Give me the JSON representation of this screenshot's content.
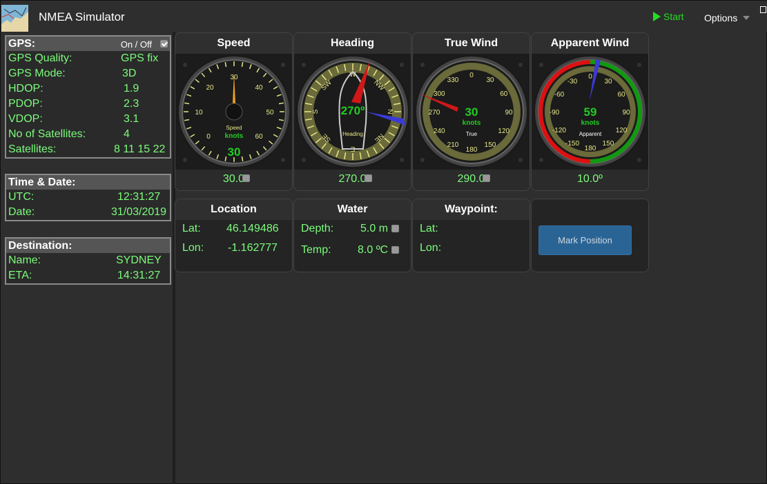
{
  "header": {
    "title": "NMEA Simulator",
    "start_label": "Start",
    "options_label": "Options"
  },
  "gps": {
    "title": "GPS:",
    "onoff_label": "On / Off",
    "rows": [
      {
        "label": "GPS Quality:",
        "value": "GPS fix"
      },
      {
        "label": "GPS Mode:",
        "value": "3D"
      },
      {
        "label": "HDOP:",
        "value": "1.9"
      },
      {
        "label": "PDOP:",
        "value": "2.3"
      },
      {
        "label": "VDOP:",
        "value": "3.1"
      },
      {
        "label": "No of Satellites:",
        "value": "4"
      },
      {
        "label": "Satellites:",
        "value": "8 11 15 22"
      }
    ]
  },
  "time": {
    "title": "Time & Date:",
    "rows": [
      {
        "label": "UTC:",
        "value": "12:31:27"
      },
      {
        "label": "Date:",
        "value": "31/03/2019"
      }
    ]
  },
  "destination": {
    "title": "Destination:",
    "rows": [
      {
        "label": "Name:",
        "value": "SYDNEY"
      },
      {
        "label": "ETA:",
        "value": "14:31:27"
      }
    ]
  },
  "gauges": {
    "speed": {
      "title": "Speed",
      "footer": "30.0",
      "unit_label": "Speed",
      "unit": "knots",
      "readout": "30",
      "value": 30,
      "ticks": [
        "0",
        "10",
        "20",
        "30",
        "40",
        "50",
        "60"
      ]
    },
    "heading": {
      "title": "Heading",
      "footer": "270.0",
      "readout": "270º",
      "unit_label": "Heading",
      "value": 270,
      "ticks": [
        "N",
        "NE",
        "E",
        "SE",
        "S",
        "SW",
        "W",
        "NW"
      ]
    },
    "true_wind": {
      "title": "True Wind",
      "footer": "290.0",
      "readout": "30",
      "unit": "knots",
      "unit_label": "True",
      "ticks": [
        "0",
        "30",
        "60",
        "90",
        "120",
        "150",
        "180",
        "210",
        "240",
        "270",
        "300",
        "330"
      ]
    },
    "apparent_wind": {
      "title": "Apparent Wind",
      "footer": "10.0º",
      "readout": "59",
      "unit": "knots",
      "unit_label": "Apparent",
      "ticks": [
        "0",
        "30",
        "60",
        "90",
        "120",
        "150",
        "180",
        "-150",
        "-120",
        "-90",
        "-60",
        "-30"
      ]
    }
  },
  "location": {
    "title": "Location",
    "lat_label": "Lat:",
    "lat": "46.149486",
    "lon_label": "Lon:",
    "lon": "-1.162777"
  },
  "water": {
    "title": "Water",
    "depth_label": "Depth:",
    "depth": "5.0 m",
    "temp_label": "Temp:",
    "temp": "8.0 ºC"
  },
  "waypoint": {
    "title": "Waypoint:",
    "lat_label": "Lat:",
    "lon_label": "Lon:"
  },
  "mark": {
    "button_label": "Mark Position"
  },
  "colors": {
    "accent_green": "#7cfc7c",
    "readout_green": "#22cc22",
    "start_green": "#22dd22",
    "button_blue": "#2a6495"
  }
}
